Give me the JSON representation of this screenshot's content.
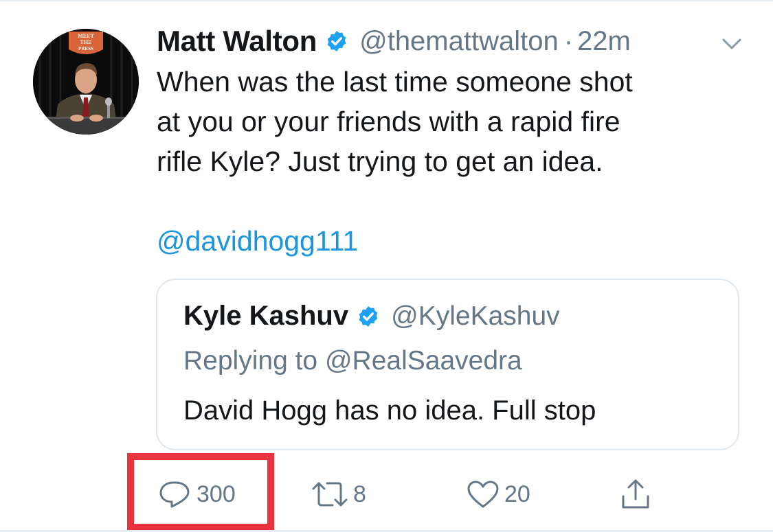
{
  "tweet": {
    "display_name": "Matt Walton",
    "verified": true,
    "handle": "@themattwalton",
    "separator": "·",
    "timestamp": "22m",
    "text_lines": [
      "When was the last time someone shot",
      "at you or your friends with a rapid fire",
      "rifle Kyle? Just trying to get an idea."
    ],
    "mention": "@davidhogg111",
    "avatar_badge_text": [
      "MEET",
      "THE",
      "PRESS"
    ]
  },
  "quoted_tweet": {
    "display_name": "Kyle Kashuv",
    "verified": true,
    "handle": "@KyleKashuv",
    "replying_to": "Replying to @RealSaavedra",
    "text": "David Hogg has no idea. Full stop"
  },
  "actions": {
    "reply_count": "300",
    "retweet_count": "8",
    "like_count": "20",
    "icons": {
      "reply": "reply-bubble-icon",
      "retweet": "retweet-icon",
      "like": "heart-icon",
      "share": "share-upload-icon"
    }
  },
  "colors": {
    "text_primary": "#14171a",
    "text_secondary": "#657786",
    "link": "#1b95e0",
    "verified": "#1da1f2",
    "highlight": "#e8343e",
    "border": "#e1e8ed"
  }
}
